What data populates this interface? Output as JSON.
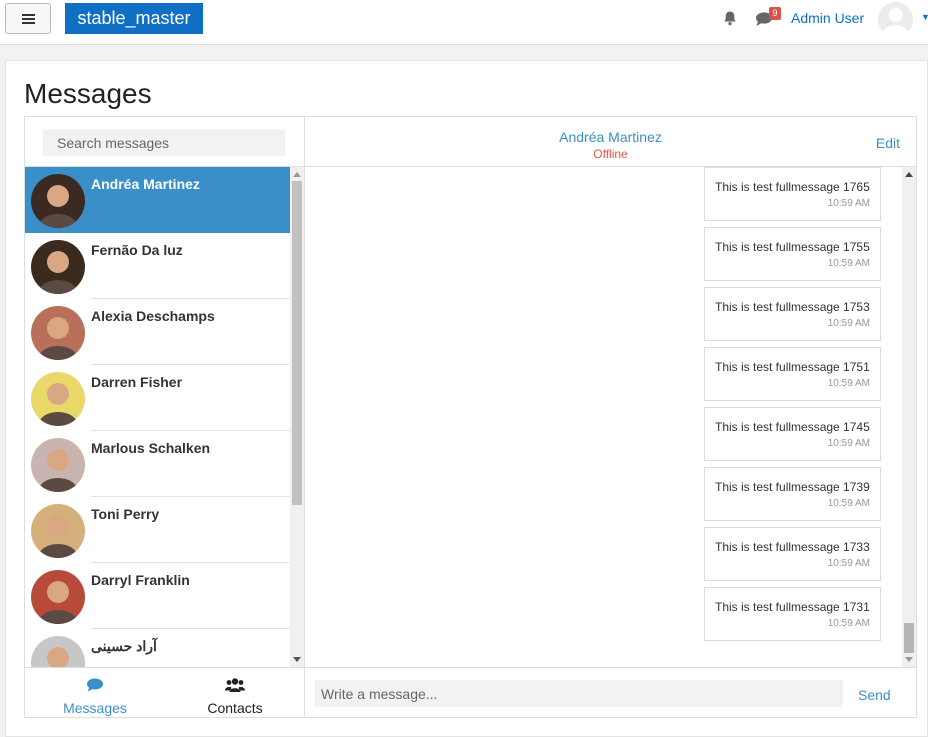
{
  "navbar": {
    "brand": "stable_master",
    "notifications_count": "9",
    "user_name": "Admin User"
  },
  "page": {
    "title": "Messages"
  },
  "search": {
    "placeholder": "Search messages"
  },
  "contacts": [
    {
      "name": "Andréa Martinez",
      "active": true,
      "avatar_color": "#3a2a22"
    },
    {
      "name": "Fernão Da luz",
      "active": false,
      "avatar_color": "#3b2b1f"
    },
    {
      "name": "Alexia Deschamps",
      "active": false,
      "avatar_color": "#b9705a"
    },
    {
      "name": "Darren Fisher",
      "active": false,
      "avatar_color": "#e9d86a"
    },
    {
      "name": "Marlous Schalken",
      "active": false,
      "avatar_color": "#c9b4b0"
    },
    {
      "name": "Toni Perry",
      "active": false,
      "avatar_color": "#d6b07c"
    },
    {
      "name": "Darryl Franklin",
      "active": false,
      "avatar_color": "#b84a3a"
    },
    {
      "name": "آراد حسینی",
      "active": false,
      "avatar_color": "#c7c7c7"
    }
  ],
  "tabs": {
    "messages": "Messages",
    "contacts": "Contacts"
  },
  "conversation": {
    "name": "Andréa Martinez",
    "status": "Offline",
    "edit_label": "Edit",
    "messages": [
      {
        "text": "This is test fullmessage 1765",
        "time": "10:59 AM"
      },
      {
        "text": "This is test fullmessage 1755",
        "time": "10:59 AM"
      },
      {
        "text": "This is test fullmessage 1753",
        "time": "10:59 AM"
      },
      {
        "text": "This is test fullmessage 1751",
        "time": "10:59 AM"
      },
      {
        "text": "This is test fullmessage 1745",
        "time": "10:59 AM"
      },
      {
        "text": "This is test fullmessage 1739",
        "time": "10:59 AM"
      },
      {
        "text": "This is test fullmessage 1733",
        "time": "10:59 AM"
      },
      {
        "text": "This is test fullmessage 1731",
        "time": "10:59 AM"
      }
    ]
  },
  "compose": {
    "placeholder": "Write a message...",
    "send_label": "Send"
  },
  "colors": {
    "brand": "#0f6fc5",
    "accent": "#3b8fc9",
    "offline": "#e5524a",
    "badge": "#d9534f"
  }
}
